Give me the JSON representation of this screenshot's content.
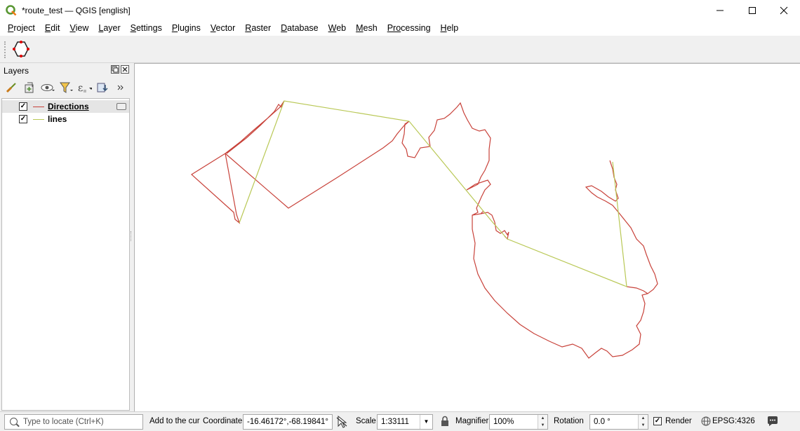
{
  "window": {
    "title": "*route_test — QGIS [english]"
  },
  "menu": [
    {
      "u": "P",
      "rest": "roject"
    },
    {
      "u": "E",
      "rest": "dit"
    },
    {
      "u": "V",
      "rest": "iew"
    },
    {
      "u": "L",
      "rest": "ayer"
    },
    {
      "u": "S",
      "rest": "ettings"
    },
    {
      "u": "P",
      "rest": "lugins"
    },
    {
      "u": "V",
      "rest": "ector"
    },
    {
      "u": "R",
      "rest": "aster"
    },
    {
      "u": "D",
      "rest": "atabase"
    },
    {
      "u": "W",
      "rest": "eb"
    },
    {
      "u": "M",
      "rest": "esh"
    },
    {
      "u": "Pro",
      "rest": "cessing",
      "u_pos": "mid"
    },
    {
      "u": "H",
      "rest": "elp"
    }
  ],
  "layers_panel": {
    "title": "Layers",
    "layers": [
      {
        "name": "Directions",
        "checked": "✓",
        "color": "#c0392b",
        "active": true
      },
      {
        "name": "lines",
        "checked": "✓",
        "color": "#b5c94a",
        "active": false
      }
    ]
  },
  "statusbar": {
    "locate_placeholder": "Type to locate (Ctrl+K)",
    "message": "Add to the cur",
    "coordinate_label": "Coordinate",
    "coordinate_value": "-16.46172°,-68.19841°",
    "scale_label": "Scale",
    "scale_value": "1:33111",
    "magnifier_label": "Magnifier",
    "magnifier_value": "100%",
    "rotation_label": "Rotation",
    "rotation_value": "0.0 °",
    "render_label": "Render",
    "render_checked": "✓",
    "crs": "EPSG:4326"
  },
  "colors": {
    "directions": "#c8423a",
    "lines": "#b9c856"
  }
}
